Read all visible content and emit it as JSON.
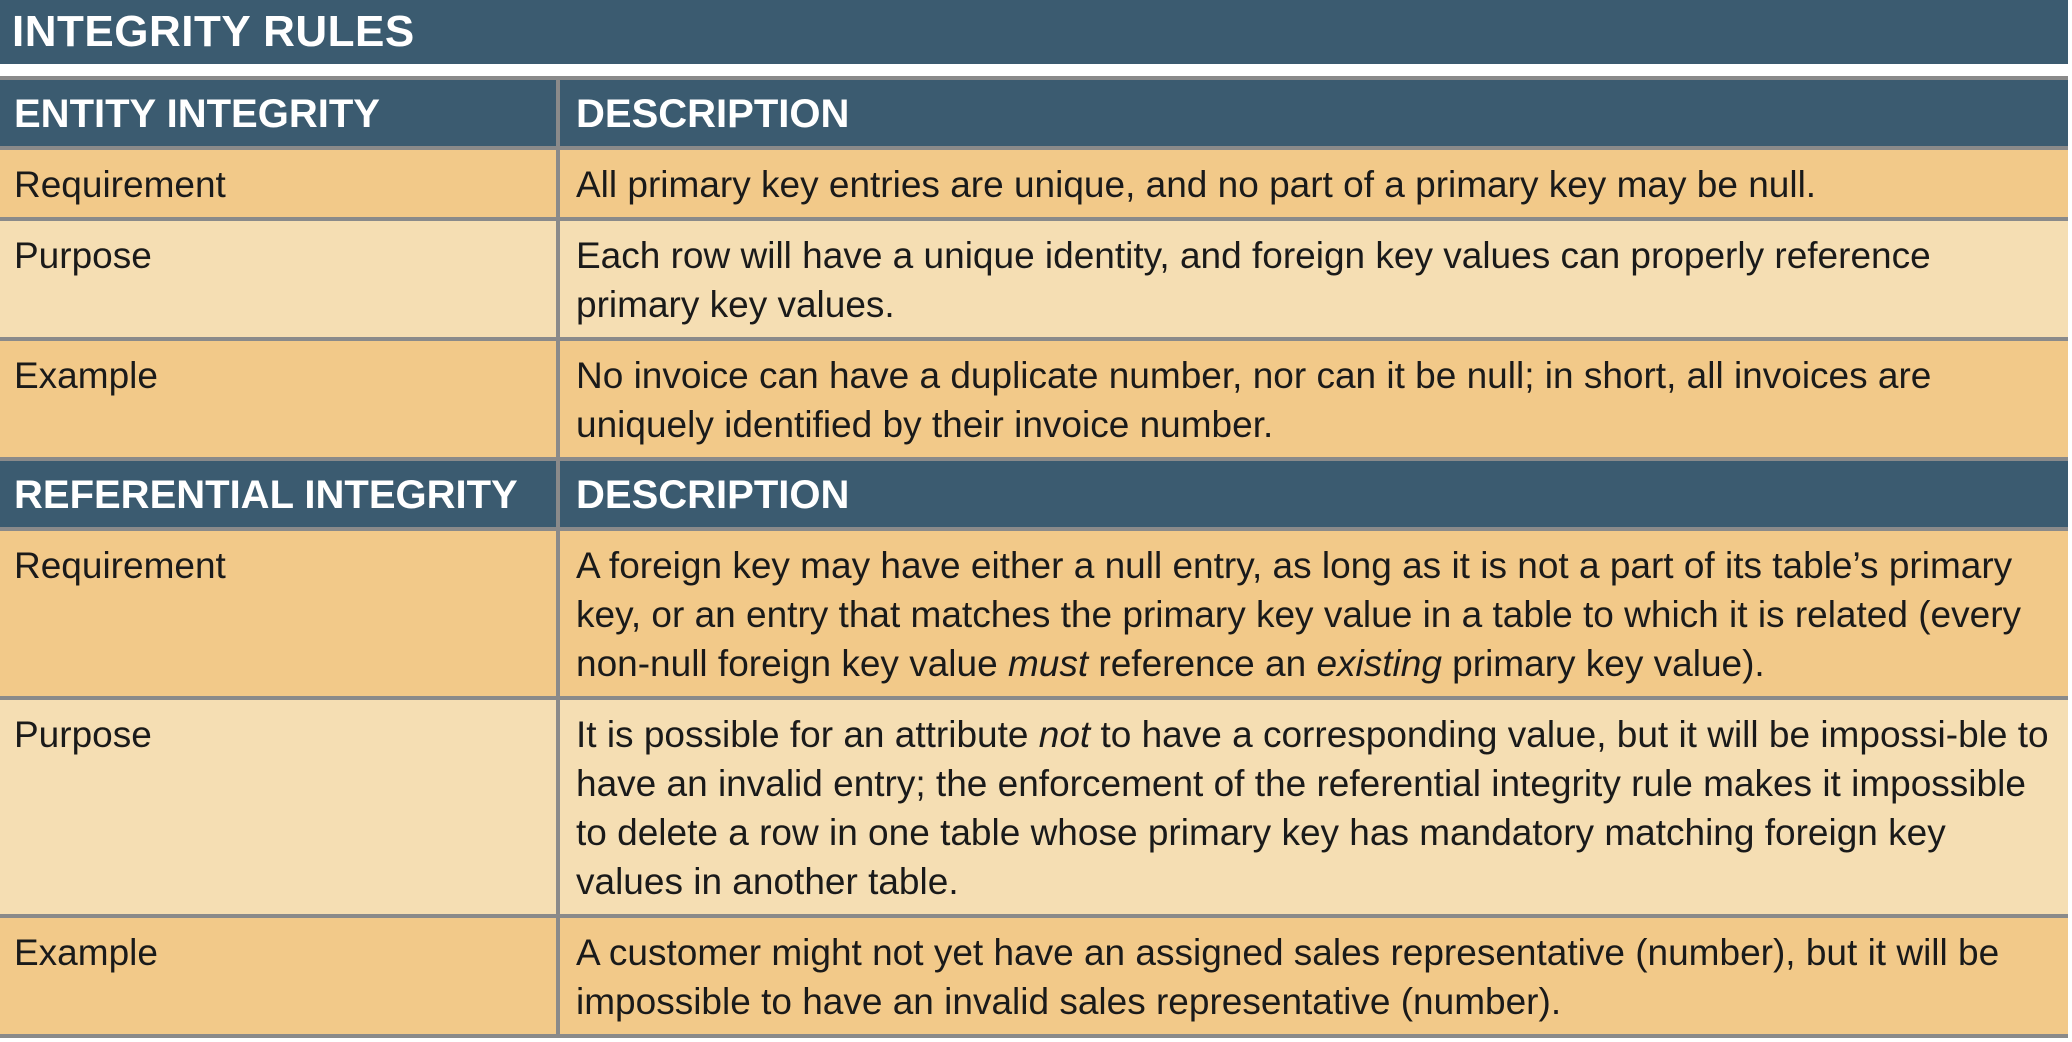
{
  "title": "INTEGRITY RULES",
  "sections": [
    {
      "header": "ENTITY INTEGRITY",
      "description_header": "DESCRIPTION",
      "rows": [
        {
          "label": "Requirement",
          "text": "All primary key entries are unique, and no part of a primary key may be null."
        },
        {
          "label": "Purpose",
          "text": "Each row will have a unique identity, and foreign key values can properly reference primary key values."
        },
        {
          "label": "Example",
          "text": "No invoice can have a duplicate number, nor can it be null; in short, all invoices are uniquely identified by their invoice number."
        }
      ]
    },
    {
      "header": "REFERENTIAL INTEGRITY",
      "description_header": "DESCRIPTION",
      "rows": [
        {
          "label": "Requirement",
          "text_parts": [
            "A foreign key may have either a null entry, as long as it is not a part of its table’s primary key, or an entry that matches the primary key value in a table to which it is related (every non-null foreign key value ",
            "must",
            " reference an ",
            "existing",
            " primary key value)."
          ]
        },
        {
          "label": "Purpose",
          "text_parts": [
            "It is possible for an attribute ",
            "not",
            " to have a corresponding value, but it will be impossi-ble to have an invalid entry; the enforcement of the referential integrity rule makes it impossible to delete a row in one table whose primary key has mandatory matching foreign key values in another table."
          ]
        },
        {
          "label": "Example",
          "text": "A customer might not yet have an assigned sales representative (number), but it will be impossible to have an invalid sales representative (number)."
        }
      ]
    }
  ],
  "colors": {
    "header_bg": "#3b5b70",
    "row_dark": "#f2c989",
    "row_light": "#f5deb3",
    "border": "#8a8a8a"
  }
}
